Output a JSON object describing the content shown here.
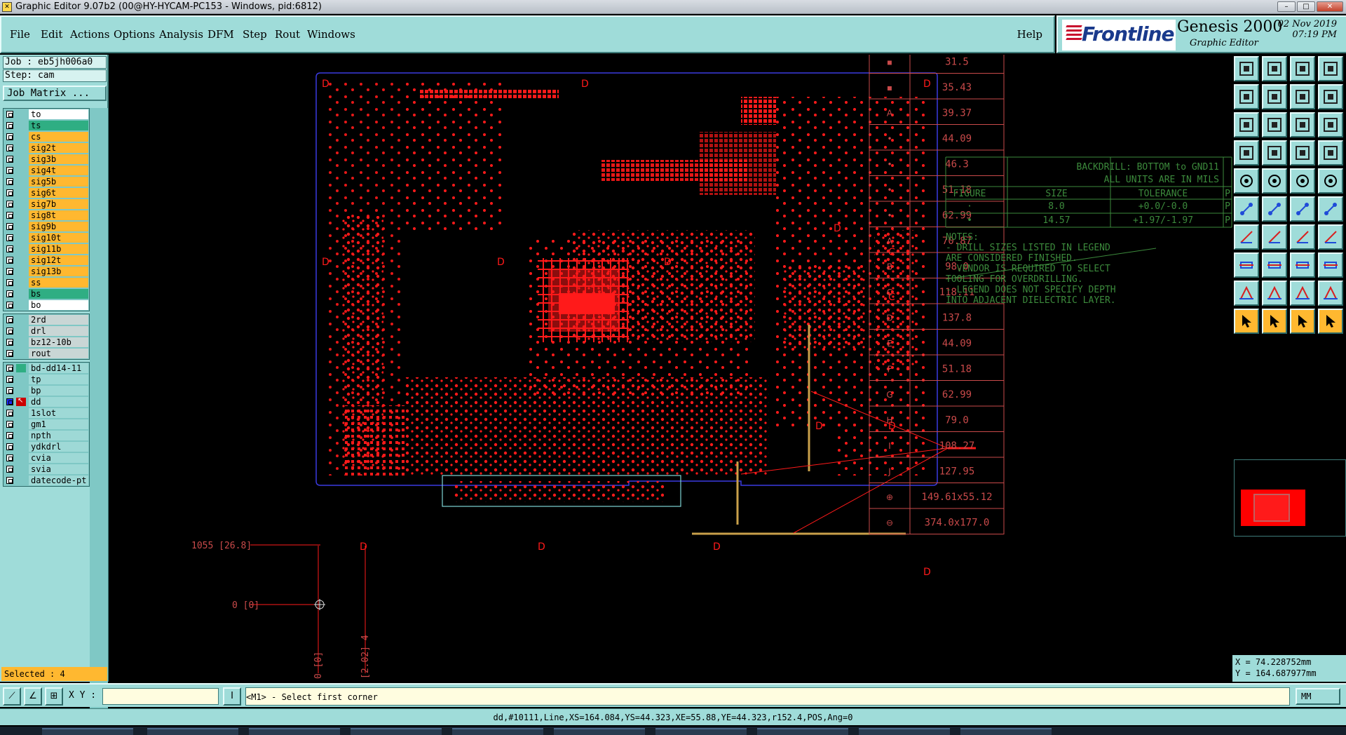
{
  "window": {
    "title": "Graphic Editor 9.07b2 (00@HY-HYCAM-PC153 - Windows, pid:6812)",
    "buttons": [
      "–",
      "□",
      "✕"
    ]
  },
  "menubar": {
    "menus": [
      "File",
      "Edit",
      "Actions",
      "Options",
      "Analysis",
      "DFM",
      "Step",
      "Rout",
      "Windows"
    ],
    "help": "Help"
  },
  "brand": {
    "logo": "Frontline",
    "product": "Genesis 2000",
    "subtitle": "Graphic Editor",
    "date": "02 Nov 2019",
    "time": "07:19 PM"
  },
  "job": {
    "job_line": "Job : eb5jh006a0",
    "step_line": "Step: cam",
    "matrix_button": "Job Matrix ..."
  },
  "layers_group1": [
    {
      "name": "to",
      "color": "white"
    },
    {
      "name": "ts",
      "color": "green"
    },
    {
      "name": "cs",
      "color": "orange"
    },
    {
      "name": "sig2t",
      "color": "orange"
    },
    {
      "name": "sig3b",
      "color": "orange"
    },
    {
      "name": "sig4t",
      "color": "orange"
    },
    {
      "name": "sig5b",
      "color": "orange"
    },
    {
      "name": "sig6t",
      "color": "orange"
    },
    {
      "name": "sig7b",
      "color": "orange"
    },
    {
      "name": "sig8t",
      "color": "orange"
    },
    {
      "name": "sig9b",
      "color": "orange"
    },
    {
      "name": "sig10t",
      "color": "orange"
    },
    {
      "name": "sig11b",
      "color": "orange"
    },
    {
      "name": "sig12t",
      "color": "orange"
    },
    {
      "name": "sig13b",
      "color": "orange"
    },
    {
      "name": "ss",
      "color": "orange"
    },
    {
      "name": "bs",
      "color": "green"
    },
    {
      "name": "bo",
      "color": "white"
    }
  ],
  "layers_group2": [
    {
      "name": "2rd",
      "color": "grey"
    },
    {
      "name": "drl",
      "color": "grey"
    },
    {
      "name": "bz12-10b",
      "color": "grey"
    },
    {
      "name": "rout",
      "color": "grey"
    }
  ],
  "layers_group3": [
    {
      "name": "bd-dd14-11",
      "color": "cyan"
    },
    {
      "name": "tp",
      "color": "cyan"
    },
    {
      "name": "bp",
      "color": "cyan"
    },
    {
      "name": "dd",
      "color": "cyan",
      "active": true
    },
    {
      "name": "1slot",
      "color": "cyan"
    },
    {
      "name": "gm1",
      "color": "cyan"
    },
    {
      "name": "npth",
      "color": "cyan"
    },
    {
      "name": "ydkdrl",
      "color": "cyan"
    },
    {
      "name": "cvia",
      "color": "cyan"
    },
    {
      "name": "svia",
      "color": "cyan"
    },
    {
      "name": "datecode-pt",
      "color": "cyan"
    }
  ],
  "selected": "Selected : 4",
  "canvas": {
    "dim_y": "1055 [26.8]",
    "dim_origin": "0 [0]",
    "dim_x0": "0 [0]",
    "dim_x1": "[2.02] 4",
    "backdrill": {
      "title": "BACKDRILL: BOTTOM to GND11",
      "units": "ALL UNITS ARE IN MILS",
      "headers": [
        "FIGURE",
        "SIZE",
        "TOLERANCE",
        "P"
      ],
      "rows": [
        [
          "·",
          "8.0",
          "+0.0/-0.0",
          "P"
        ],
        [
          "•",
          "14.57",
          "+1.97/-1.97",
          "P"
        ]
      ],
      "notes": [
        "NOTES:",
        "- DRILL SIZES LISTED IN LEGEND",
        "  ARE CONSIDERED FINISHED.",
        "- VENDOR IS REQUIRED TO SELECT",
        "  TOOLING FOR OVERDRILLING.",
        "- LEGEND DOES NOT SPECIFY DEPTH",
        "  INTO ADJACENT DIELECTRIC LAYER."
      ]
    },
    "drill_legend": [
      {
        "sym": "▪",
        "value": "31.5"
      },
      {
        "sym": "▪",
        "value": "35.43"
      },
      {
        "sym": "A",
        "value": "39.37"
      },
      {
        "sym": "•",
        "value": "44.09"
      },
      {
        "sym": "•",
        "value": "46.3"
      },
      {
        "sym": "•",
        "value": "51.18"
      },
      {
        "sym": "•",
        "value": "62.99"
      },
      {
        "sym": "A",
        "value": "70.87"
      },
      {
        "sym": "B",
        "value": "98.0"
      },
      {
        "sym": "C",
        "value": "118.11"
      },
      {
        "sym": "D",
        "value": "137.8"
      },
      {
        "sym": "E",
        "value": "44.09"
      },
      {
        "sym": "F",
        "value": "51.18"
      },
      {
        "sym": "G",
        "value": "62.99"
      },
      {
        "sym": "H",
        "value": "79.0"
      },
      {
        "sym": "I",
        "value": "108.27"
      },
      {
        "sym": "J",
        "value": "127.95"
      },
      {
        "sym": "⊕",
        "value": "149.61x55.12"
      },
      {
        "sym": "⊖",
        "value": "374.0x177.0"
      }
    ]
  },
  "coords": {
    "x": "X = 74.228752mm",
    "y": "Y = 164.687977mm"
  },
  "cmdbar": {
    "xy_label": "X Y :",
    "xy_value": "",
    "prompt": "<M1> - Select first corner",
    "unit": "MM"
  },
  "status": "dd,#10111,Line,XS=164.084,YS=44.323,XE=55.88,YE=44.323,r152.4,POS,Ang=0",
  "colors": {
    "panel": "#9fdcd9",
    "drill": "#ff1a1a",
    "legend_text": "#c94a4a",
    "notes_green": "#3c8a3c",
    "outline": "#3a3ae0"
  }
}
